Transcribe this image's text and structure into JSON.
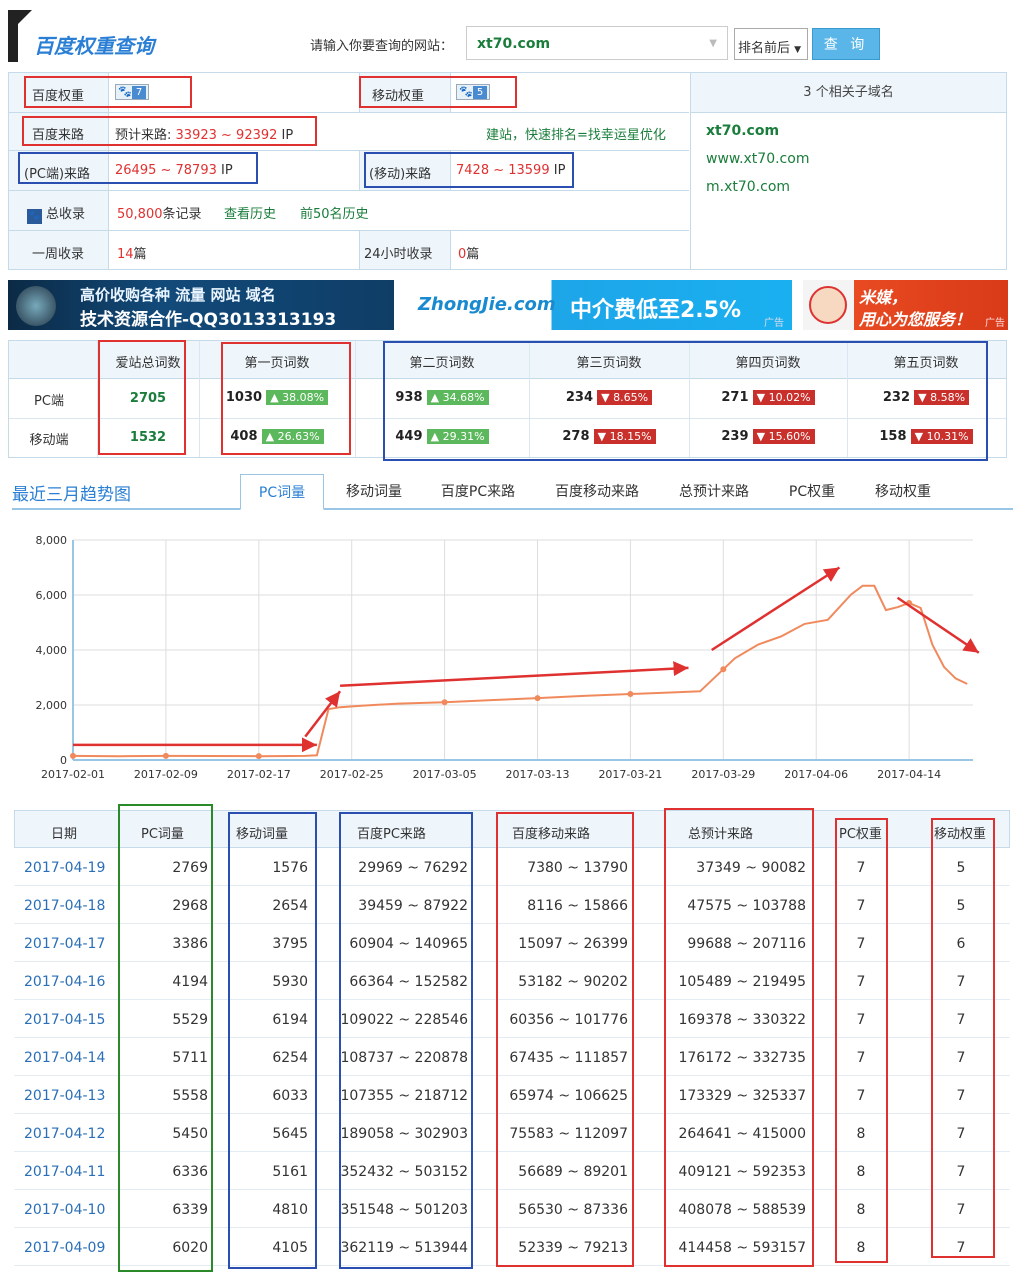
{
  "header": {
    "title": "百度权重查询",
    "query_label": "请输入你要查询的网站：",
    "query_value": "xt70.com",
    "rank_select": "排名前后",
    "query_button": "查 询"
  },
  "info": {
    "baidu_weight_label": "百度权重",
    "baidu_weight_value": "7",
    "mobile_weight_label": "移动权重",
    "mobile_weight_value": "5",
    "baidu_traffic_label": "百度来路",
    "baidu_traffic_prefix": "预计来路:",
    "baidu_traffic_value": "33923 ~ 92392",
    "ip": "IP",
    "promo_text": "建站，快速排名=找幸运星优化",
    "pc_traffic_label": "(PC端)来路",
    "pc_traffic_value": "26495 ~ 78793",
    "mobile_traffic_label": "(移动)来路",
    "mobile_traffic_value": "7428 ~ 13599",
    "index_label": "总收录",
    "index_value": "50,800",
    "index_unit": "条记录",
    "history_link": "查看历史",
    "top50_link": "前50名历史",
    "week_label": "一周收录",
    "week_value": "14",
    "day_label": "24小时收录",
    "day_value": "0",
    "unit_pian": "篇",
    "subdomain_header": "3 个相关子域名",
    "subdomains": [
      "xt70.com",
      "www.xt70.com",
      "m.xt70.com"
    ]
  },
  "ads": {
    "ad1_line1": "高价收购各种 流量 网站 域名",
    "ad1_line2": "技术资源合作-QQ3013313193",
    "ad2_logo": "ZhongJie.com",
    "ad2_text": "中介费低至2.5%",
    "ad3_line1": "米媒，",
    "ad3_line2": "用心为您服务！",
    "ad_mark": "广告"
  },
  "stats": {
    "headers": [
      "爱站总词数",
      "第一页词数",
      "第二页词数",
      "第三页词数",
      "第四页词数",
      "第五页词数"
    ],
    "rows": [
      {
        "label": "PC端",
        "total": "2705",
        "p1": "1030",
        "p1c": "38.08%",
        "p2": "938",
        "p2c": "34.68%",
        "p3": "234",
        "p3c": "8.65%",
        "p4": "271",
        "p4c": "10.02%",
        "p5": "232",
        "p5c": "8.58%"
      },
      {
        "label": "移动端",
        "total": "1532",
        "p1": "408",
        "p1c": "26.63%",
        "p2": "449",
        "p2c": "29.31%",
        "p3": "278",
        "p3c": "18.15%",
        "p4": "239",
        "p4c": "15.60%",
        "p5": "158",
        "p5c": "10.31%"
      }
    ]
  },
  "trend": {
    "title": "最近三月趋势图",
    "tabs": [
      "PC词量",
      "移动词量",
      "百度PC来路",
      "百度移动来路",
      "总预计来路",
      "PC权重",
      "移动权重"
    ]
  },
  "chart_data": {
    "type": "line",
    "xlabels": [
      "2017-02-01",
      "2017-02-09",
      "2017-02-17",
      "2017-02-25",
      "2017-03-05",
      "2017-03-13",
      "2017-03-21",
      "2017-03-29",
      "2017-04-06",
      "2017-04-14"
    ],
    "ylim": [
      0,
      8000
    ],
    "yticks": [
      "0",
      "2,000",
      "4,000",
      "6,000",
      "8,000"
    ],
    "x_start": "2017-02-01",
    "points": [
      [
        "2017-02-01",
        150
      ],
      [
        "2017-02-05",
        140
      ],
      [
        "2017-02-09",
        150
      ],
      [
        "2017-02-13",
        145
      ],
      [
        "2017-02-17",
        140
      ],
      [
        "2017-02-21",
        150
      ],
      [
        "2017-02-22",
        170
      ],
      [
        "2017-02-23",
        1850
      ],
      [
        "2017-02-24",
        1920
      ],
      [
        "2017-02-26",
        1980
      ],
      [
        "2017-03-01",
        2050
      ],
      [
        "2017-03-05",
        2100
      ],
      [
        "2017-03-09",
        2180
      ],
      [
        "2017-03-13",
        2250
      ],
      [
        "2017-03-17",
        2330
      ],
      [
        "2017-03-21",
        2400
      ],
      [
        "2017-03-25",
        2460
      ],
      [
        "2017-03-27",
        2500
      ],
      [
        "2017-03-29",
        3300
      ],
      [
        "2017-03-30",
        3700
      ],
      [
        "2017-04-01",
        4200
      ],
      [
        "2017-04-03",
        4500
      ],
      [
        "2017-04-05",
        4950
      ],
      [
        "2017-04-07",
        5100
      ],
      [
        "2017-04-09",
        6020
      ],
      [
        "2017-04-10",
        6339
      ],
      [
        "2017-04-11",
        6336
      ],
      [
        "2017-04-12",
        5450
      ],
      [
        "2017-04-13",
        5558
      ],
      [
        "2017-04-14",
        5711
      ],
      [
        "2017-04-15",
        5529
      ],
      [
        "2017-04-16",
        4194
      ],
      [
        "2017-04-17",
        3386
      ],
      [
        "2017-04-18",
        2968
      ],
      [
        "2017-04-19",
        2769
      ]
    ],
    "marked_dates": [
      "2017-02-01",
      "2017-02-09",
      "2017-02-17",
      "2017-02-25",
      "2017-03-05",
      "2017-03-13",
      "2017-03-21",
      "2017-03-29",
      "2017-04-06",
      "2017-04-14"
    ],
    "line_color": "#f08a5d",
    "arrow_color": "#e03131"
  },
  "table": {
    "headers": [
      "日期",
      "PC词量",
      "移动词量",
      "百度PC来路",
      "百度移动来路",
      "总预计来路",
      "PC权重",
      "移动权重"
    ],
    "rows": [
      [
        "2017-04-19",
        "2769",
        "1576",
        "29969 ~ 76292",
        "7380 ~ 13790",
        "37349 ~ 90082",
        "7",
        "5"
      ],
      [
        "2017-04-18",
        "2968",
        "2654",
        "39459 ~ 87922",
        "8116 ~ 15866",
        "47575 ~ 103788",
        "7",
        "5"
      ],
      [
        "2017-04-17",
        "3386",
        "3795",
        "60904 ~ 140965",
        "15097 ~ 26399",
        "99688 ~ 207116",
        "7",
        "6"
      ],
      [
        "2017-04-16",
        "4194",
        "5930",
        "66364 ~ 152582",
        "53182 ~ 90202",
        "105489 ~ 219495",
        "7",
        "7"
      ],
      [
        "2017-04-15",
        "5529",
        "6194",
        "109022 ~ 228546",
        "60356 ~ 101776",
        "169378 ~ 330322",
        "7",
        "7"
      ],
      [
        "2017-04-14",
        "5711",
        "6254",
        "108737 ~ 220878",
        "67435 ~ 111857",
        "176172 ~ 332735",
        "7",
        "7"
      ],
      [
        "2017-04-13",
        "5558",
        "6033",
        "107355 ~ 218712",
        "65974 ~ 106625",
        "173329 ~ 325337",
        "7",
        "7"
      ],
      [
        "2017-04-12",
        "5450",
        "5645",
        "189058 ~ 302903",
        "75583 ~ 112097",
        "264641 ~ 415000",
        "8",
        "7"
      ],
      [
        "2017-04-11",
        "6336",
        "5161",
        "352432 ~ 503152",
        "56689 ~ 89201",
        "409121 ~ 592353",
        "8",
        "7"
      ],
      [
        "2017-04-10",
        "6339",
        "4810",
        "351548 ~ 501203",
        "56530 ~ 87336",
        "408078 ~ 588539",
        "8",
        "7"
      ],
      [
        "2017-04-09",
        "6020",
        "4105",
        "362119 ~ 513944",
        "52339 ~ 79213",
        "414458 ~ 593157",
        "8",
        "7"
      ]
    ]
  },
  "colors": {
    "accent": "#2a7fd4",
    "red": "#e03131",
    "green": "#1a7d3b",
    "header_bg": "#eef6fc",
    "border": "#c6dbe9"
  }
}
